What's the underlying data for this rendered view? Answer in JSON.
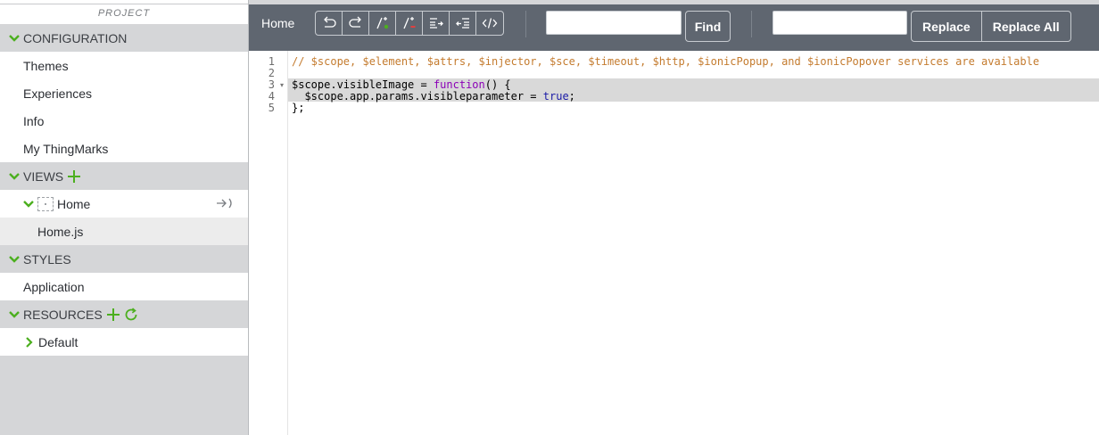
{
  "sidebar": {
    "project_label": "PROJECT",
    "sections": {
      "configuration": {
        "label": "CONFIGURATION",
        "items": [
          "Themes",
          "Experiences",
          "Info",
          "My ThingMarks"
        ]
      },
      "views": {
        "label": "VIEWS",
        "view_name": "Home",
        "file_name": "Home.js"
      },
      "styles": {
        "label": "STYLES",
        "items": [
          "Application"
        ]
      },
      "resources": {
        "label": "RESOURCES",
        "items": [
          "Default"
        ]
      }
    },
    "accent_color": "#4caf1f"
  },
  "toolbar": {
    "title": "Home",
    "buttons": [
      "undo-icon",
      "redo-icon",
      "comment-add-icon",
      "comment-remove-icon",
      "indent-icon",
      "outdent-icon",
      "code-format-icon"
    ],
    "find_value": "",
    "find_label": "Find",
    "replace_value": "",
    "replace_label": "Replace",
    "replace_all_label": "Replace All"
  },
  "editor": {
    "line_numbers": [
      "1",
      "2",
      "3",
      "4",
      "5"
    ],
    "lines": {
      "l1": "// $scope, $element, $attrs, $injector, $sce, $timeout, $http, $ionicPopup, and $ionicPopover services are available",
      "l2": "",
      "l3_a": "$scope.visibleImage = ",
      "l3_kw": "function",
      "l3_b": "() {",
      "l4_a": "  $scope.app.params.visibleparameter = ",
      "l4_con": "true",
      "l4_b": ";",
      "l5": "};"
    }
  }
}
